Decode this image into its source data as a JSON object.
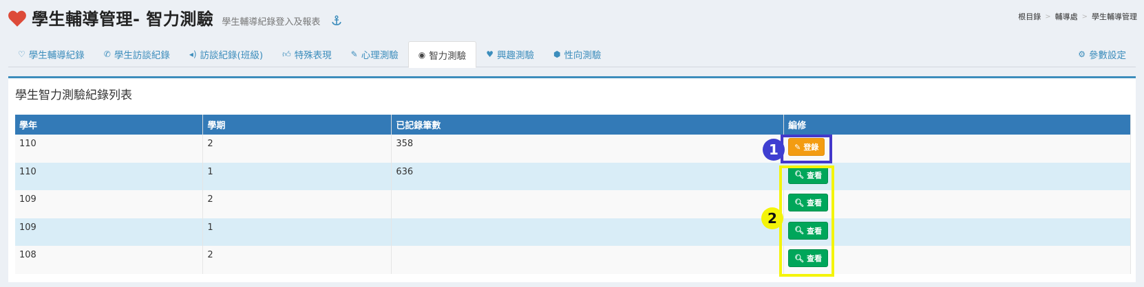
{
  "header": {
    "title": "學生輔導管理- 智力測驗",
    "subtitle": "學生輔導紀錄登入及報表"
  },
  "breadcrumb": [
    "根目錄",
    "輔導處",
    "學生輔導管理"
  ],
  "tabs": [
    {
      "label": "學生輔導紀錄",
      "icon": "heart-outline-icon"
    },
    {
      "label": "學生訪談紀錄",
      "icon": "phone-icon"
    },
    {
      "label": "訪談紀錄(班級)",
      "icon": "volume-icon"
    },
    {
      "label": "特殊表現",
      "icon": "thumbs-up-icon"
    },
    {
      "label": "心理測驗",
      "icon": "edit-icon"
    },
    {
      "label": "智力測驗",
      "icon": "eye-icon",
      "active": true
    },
    {
      "label": "興趣測驗",
      "icon": "heartbeat-icon"
    },
    {
      "label": "性向測驗",
      "icon": "cubes-icon"
    }
  ],
  "settings_tab": {
    "label": "參數設定",
    "icon": "gear-icon"
  },
  "panel": {
    "title": "學生智力測驗紀錄列表",
    "columns": [
      "學年",
      "學期",
      "已記錄筆數",
      "編修"
    ],
    "rows": [
      {
        "year": "110",
        "term": "2",
        "count": "358",
        "action": "登錄"
      },
      {
        "year": "110",
        "term": "1",
        "count": "636",
        "action": "查看"
      },
      {
        "year": "109",
        "term": "2",
        "count": "",
        "action": "查看"
      },
      {
        "year": "109",
        "term": "1",
        "count": "",
        "action": "查看"
      },
      {
        "year": "108",
        "term": "2",
        "count": "",
        "action": "查看"
      }
    ]
  },
  "annotations": {
    "marker1": "1",
    "marker2": "2"
  },
  "colors": {
    "primary": "#3c8dbc",
    "header_bg": "#337ab7",
    "warning": "#f39c12",
    "success": "#00a65a",
    "highlight_blue": "#4338ca",
    "highlight_yellow": "#f4f40a"
  }
}
